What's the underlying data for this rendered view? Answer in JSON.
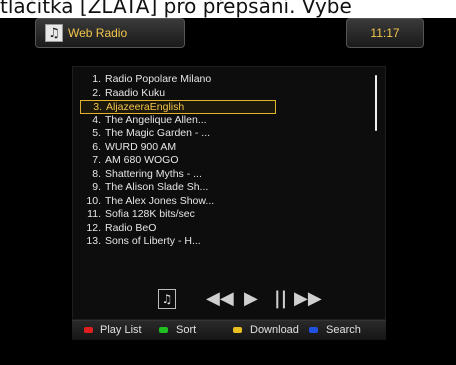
{
  "top_strip_text": "tlačítka [ZLATÁ] pro přepsání. Vybe",
  "header": {
    "title": "Web Radio",
    "icon": "music-note-icon",
    "clock": "11:17"
  },
  "playlist": {
    "items": [
      {
        "num": "1.",
        "name": "Radio Popolare Milano"
      },
      {
        "num": "2.",
        "name": "Raadio Kuku"
      },
      {
        "num": "3.",
        "name": "AljazeeraEnglish"
      },
      {
        "num": "4.",
        "name": "The Angelique Allen..."
      },
      {
        "num": "5.",
        "name": "The Magic Garden - ..."
      },
      {
        "num": "6.",
        "name": "WURD 900 AM"
      },
      {
        "num": "7.",
        "name": "AM 680 WOGO"
      },
      {
        "num": "8.",
        "name": "Shattering Myths - ..."
      },
      {
        "num": "9.",
        "name": "The Alison Slade Sh..."
      },
      {
        "num": "10.",
        "name": "The Alex Jones Show..."
      },
      {
        "num": "11.",
        "name": "Sofia 128K bits/sec"
      },
      {
        "num": "12.",
        "name": "Radio BeO"
      },
      {
        "num": "13.",
        "name": "Sons of Liberty - H..."
      }
    ],
    "selected_index": 2
  },
  "controls": {
    "music": "♫",
    "rewind": "◀◀",
    "play": "▶",
    "pause": "||",
    "forward": "▶▶"
  },
  "color_keys": [
    {
      "label": "Play List",
      "color": "#e02020"
    },
    {
      "label": "Sort",
      "color": "#20c020"
    },
    {
      "label": "Download",
      "color": "#e8c020"
    },
    {
      "label": "Search",
      "color": "#2050e0"
    }
  ]
}
